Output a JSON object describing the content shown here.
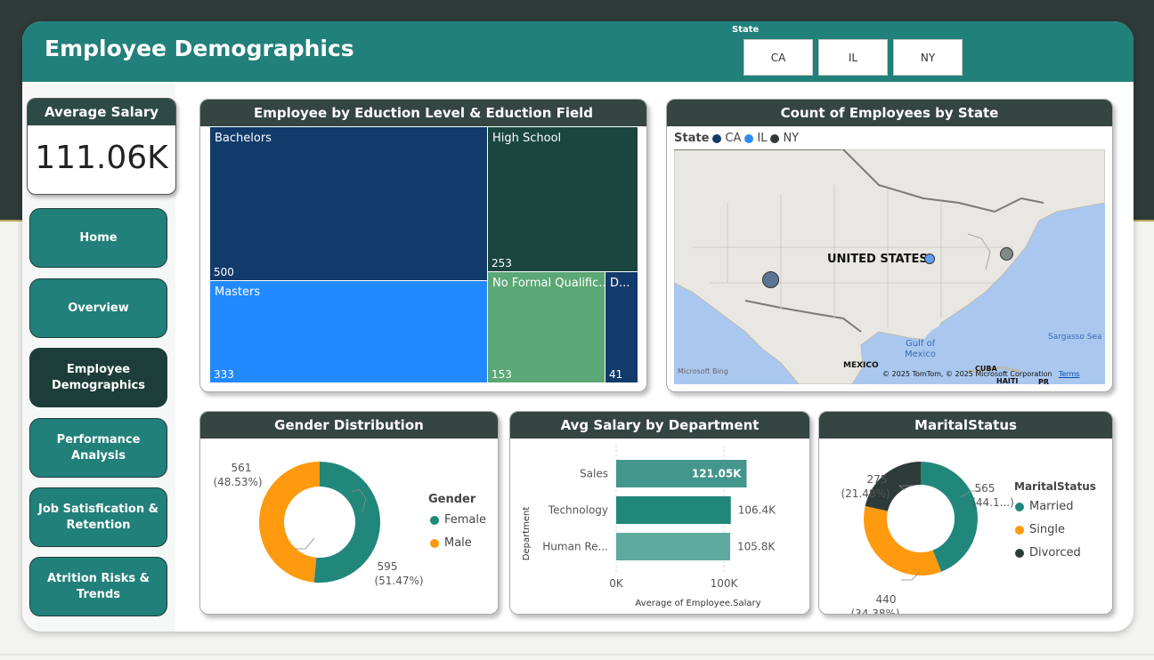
{
  "header": {
    "title": "Employee Demographics",
    "state_label": "State",
    "state_buttons": [
      "CA",
      "IL",
      "NY"
    ]
  },
  "kpi": {
    "label": "Average Salary",
    "value": "111.06K"
  },
  "nav": {
    "items": [
      "Home",
      "Overview",
      "Employee Demographics",
      "Performance Analysis",
      "Job Satisfication & Retention",
      "Atrition Risks & Trends"
    ],
    "active": "Employee Demographics"
  },
  "treemap": {
    "title": "Employee by Eduction Level & Eduction Field",
    "tiles": [
      {
        "label": "Bachelors",
        "value": "500",
        "color": "#123a6b"
      },
      {
        "label": "High School",
        "value": "253",
        "color": "#1b4640"
      },
      {
        "label": "Masters",
        "value": "333",
        "color": "#2289ff"
      },
      {
        "label": "No Formal Qualific...",
        "value": "153",
        "color": "#5ba775"
      },
      {
        "label": "D...",
        "value": "41",
        "color": "#123a6b"
      }
    ]
  },
  "map": {
    "title": "Count of Employees by State",
    "legend_title": "State",
    "legend": [
      {
        "name": "CA",
        "color": "#123a6b"
      },
      {
        "name": "IL",
        "color": "#2f8cf5"
      },
      {
        "name": "NY",
        "color": "#2e3b38"
      }
    ],
    "labels": {
      "country": "UNITED STATES",
      "gulf_1": "Gulf of",
      "gulf_2": "Mexico",
      "mexico": "MEXICO",
      "cuba": "CUBA",
      "haiti": "HAITI",
      "pr": "PR",
      "sargasso": "Sargasso Sea",
      "logo": "Microsoft Bing",
      "copyright": "© 2025 TomTom, © 2025 Microsoft Corporation",
      "terms": "Terms"
    }
  },
  "gender": {
    "title": "Gender Distribution",
    "legend_title": "Gender",
    "chart_data": {
      "type": "pie",
      "categories": [
        "Female",
        "Male"
      ],
      "values": [
        595,
        561
      ],
      "labels": [
        "595",
        "561"
      ],
      "percents": [
        "(51.47%)",
        "(48.53%)"
      ],
      "colors": [
        "#22877b",
        "#ff9a0e"
      ]
    }
  },
  "dept": {
    "title": "Avg Salary by Department",
    "chart_data": {
      "type": "bar",
      "categories": [
        "Sales",
        "Technology",
        "Human Re..."
      ],
      "values": [
        121.05,
        106.4,
        105.8
      ],
      "data_labels": [
        "121.05K",
        "106.4K",
        "105.8K"
      ],
      "colors": [
        "#43968c",
        "#22877b",
        "#5eaa9e"
      ],
      "xlabel": "Average of Employee.Salary",
      "ylabel": "Department",
      "xticks": [
        "0K",
        "100K"
      ],
      "xtick_values": [
        0,
        100
      ],
      "xlim": [
        0,
        125
      ]
    }
  },
  "marital": {
    "title": "MaritalStatus",
    "legend_title": "MaritalStatus",
    "chart_data": {
      "type": "pie",
      "categories": [
        "Married",
        "Single",
        "Divorced"
      ],
      "values": [
        565,
        440,
        275
      ],
      "labels": [
        "565",
        "440",
        "275"
      ],
      "percents": [
        "(44.1...)",
        "(34.38%)",
        "(21.48%)"
      ],
      "colors": [
        "#22877b",
        "#ff9a0e",
        "#2e3b38"
      ]
    }
  }
}
